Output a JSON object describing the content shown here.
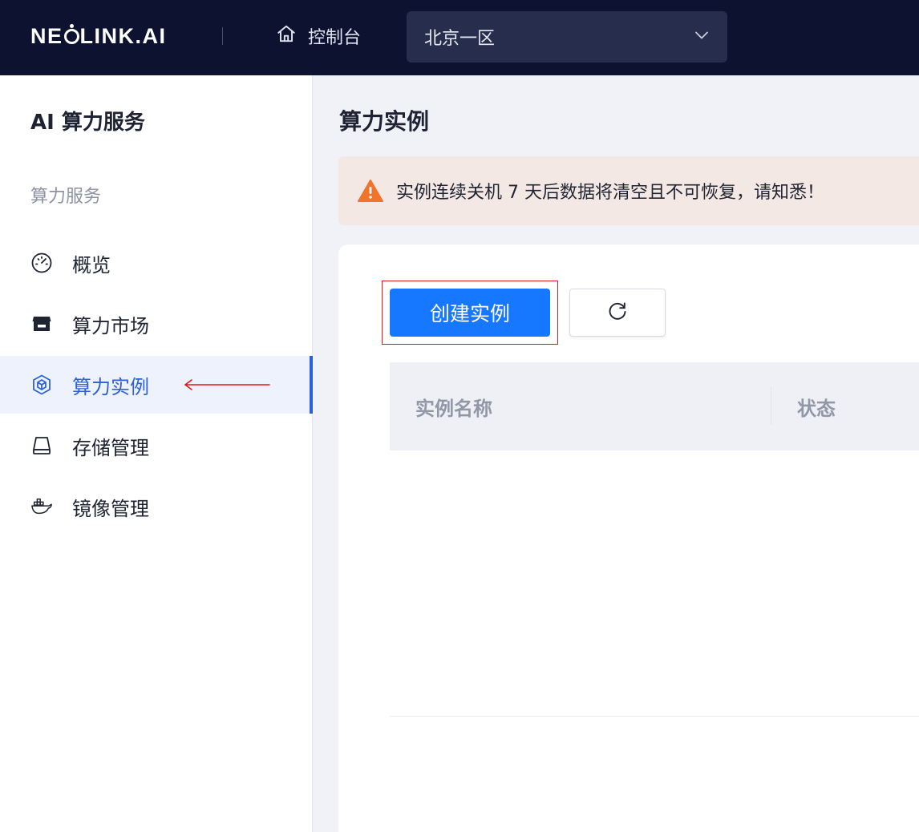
{
  "app": {
    "logo_pre": "NE",
    "logo_post": "LINK.AI"
  },
  "topbar": {
    "console_label": "控制台",
    "console_icon": "home-icon",
    "region": {
      "value": "北京一区",
      "icon": "chevron-down-icon"
    }
  },
  "sidebar": {
    "title": "AI 算力服务",
    "group_label": "算力服务",
    "items": [
      {
        "label": "概览",
        "icon": "dashboard-gauge-icon",
        "active": false
      },
      {
        "label": "算力市场",
        "icon": "market-store-icon",
        "active": false
      },
      {
        "label": "算力实例",
        "icon": "instance-cube-icon",
        "active": true
      },
      {
        "label": "存储管理",
        "icon": "storage-drive-icon",
        "active": false
      },
      {
        "label": "镜像管理",
        "icon": "docker-whale-icon",
        "active": false
      }
    ]
  },
  "main": {
    "page_title": "算力实例",
    "alert": {
      "text": "实例连续关机 7 天后数据将清空且不可恢复，请知悉！",
      "icon": "warning-triangle-icon"
    },
    "toolbar": {
      "create_label": "创建实例",
      "refresh_icon": "refresh-icon"
    },
    "table": {
      "columns": [
        "实例名称",
        "状态"
      ]
    }
  },
  "colors": {
    "topbar_bg": "#0c1230",
    "accent": "#1677ff",
    "active_nav": "#2c62d9",
    "warning": "#f0742b",
    "annotation": "#e3161c"
  }
}
